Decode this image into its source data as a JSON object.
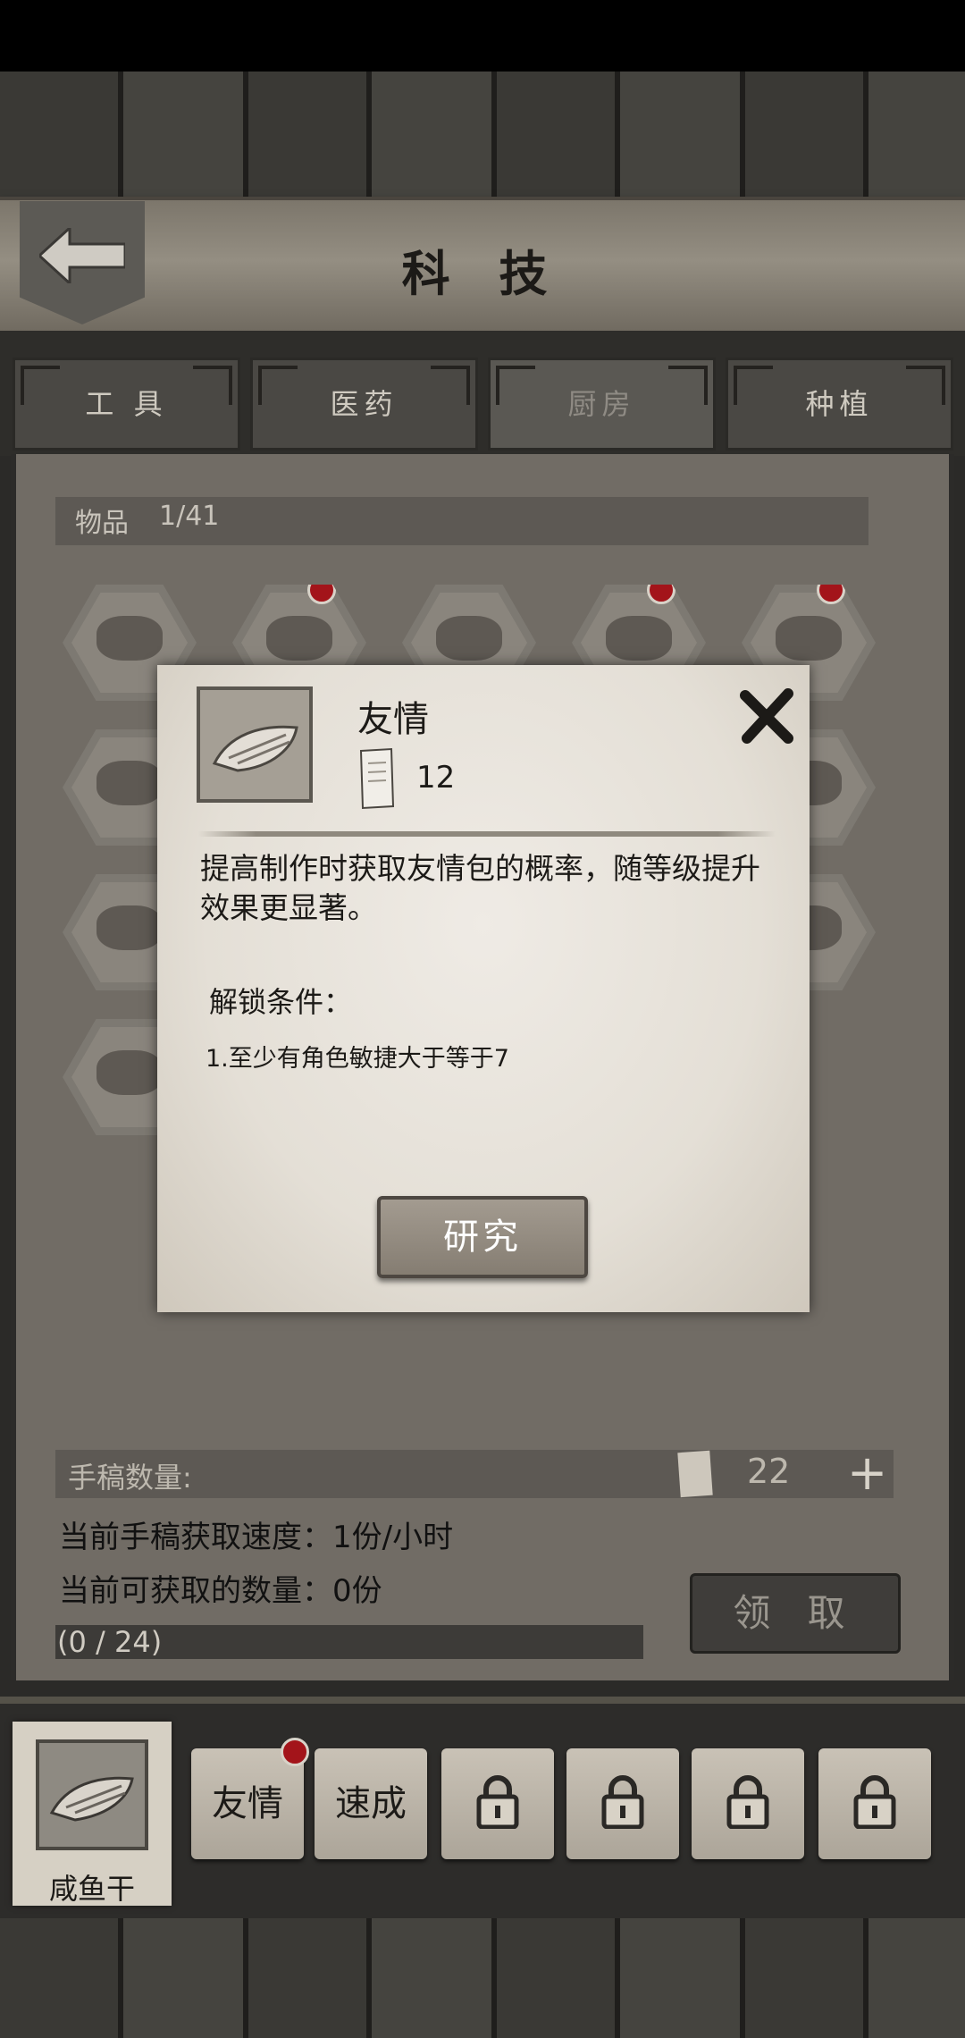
{
  "header": {
    "title": "科 技"
  },
  "tabs": [
    {
      "label": "工 具",
      "active": false
    },
    {
      "label": "医药",
      "active": false
    },
    {
      "label": "厨房",
      "active": true
    },
    {
      "label": "种植",
      "active": false
    }
  ],
  "items": {
    "label": "物品",
    "count": "1/41"
  },
  "manuscript": {
    "label": "手稿数量:",
    "count": "22",
    "speed": "当前手稿获取速度：1份/小时",
    "available": "当前可获取的数量：0份",
    "progress_text": "(0 / 24)",
    "progress_fraction": 0,
    "collect_label": "领 取"
  },
  "selected_item": {
    "name": "咸鱼干"
  },
  "skills": [
    {
      "label": "友情",
      "locked": false,
      "badge": true
    },
    {
      "label": "速成",
      "locked": false,
      "badge": false
    },
    {
      "label": "",
      "locked": true,
      "badge": false
    },
    {
      "label": "",
      "locked": true,
      "badge": false
    },
    {
      "label": "",
      "locked": true,
      "badge": false
    },
    {
      "label": "",
      "locked": true,
      "badge": false
    }
  ],
  "modal": {
    "title": "友情",
    "cost": "12",
    "description": "提高制作时获取友情包的概率，随等级提升效果更显著。",
    "unlock_title": "解锁条件：",
    "condition": "1.至少有角色敏捷大于等于7",
    "research_label": "研究"
  },
  "colors": {
    "badge_red": "#a3141a",
    "parchment": "#ebe7e0",
    "wood_dark": "#2e2d2a"
  }
}
